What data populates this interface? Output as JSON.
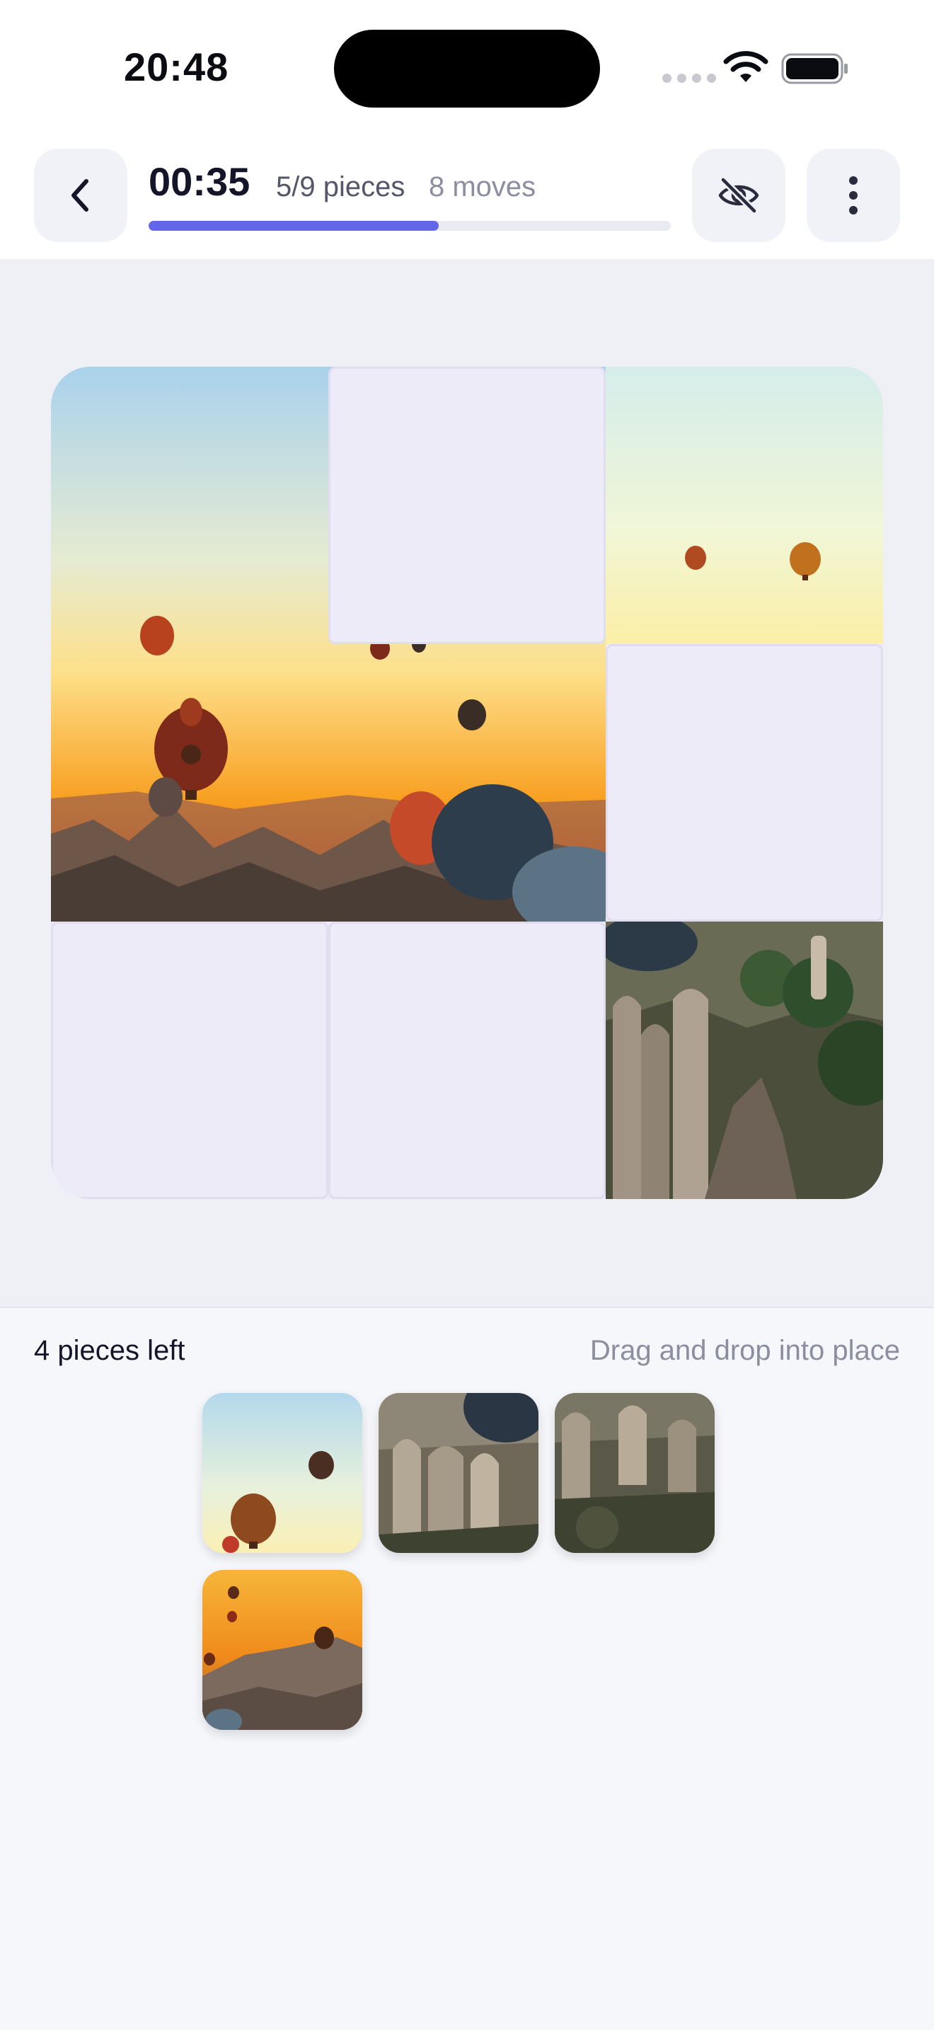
{
  "status_bar": {
    "time": "20:48"
  },
  "header": {
    "timer": "00:35",
    "pieces": "5/9 pieces",
    "moves": "8 moves",
    "progress": 0.556,
    "back_icon": "chevron-left-icon",
    "hint_icon": "eye-off-icon",
    "menu_icon": "more-vertical-icon"
  },
  "board": {
    "grid": "3x3",
    "cells": [
      {
        "position": 1,
        "state": "placed"
      },
      {
        "position": 2,
        "state": "empty"
      },
      {
        "position": 3,
        "state": "placed"
      },
      {
        "position": 4,
        "state": "placed"
      },
      {
        "position": 5,
        "state": "placed"
      },
      {
        "position": 6,
        "state": "empty"
      },
      {
        "position": 7,
        "state": "empty"
      },
      {
        "position": 8,
        "state": "empty"
      },
      {
        "position": 9,
        "state": "placed"
      }
    ]
  },
  "tray": {
    "pieces_left": "4 pieces left",
    "hint": "Drag and drop into place",
    "pieces": [
      {
        "id": "piece-a"
      },
      {
        "id": "piece-b"
      },
      {
        "id": "piece-c"
      },
      {
        "id": "piece-d"
      }
    ]
  },
  "colors": {
    "accent": "#6366E9",
    "board_bg": "#EEF0F5",
    "slot": "#EDEBF8"
  }
}
